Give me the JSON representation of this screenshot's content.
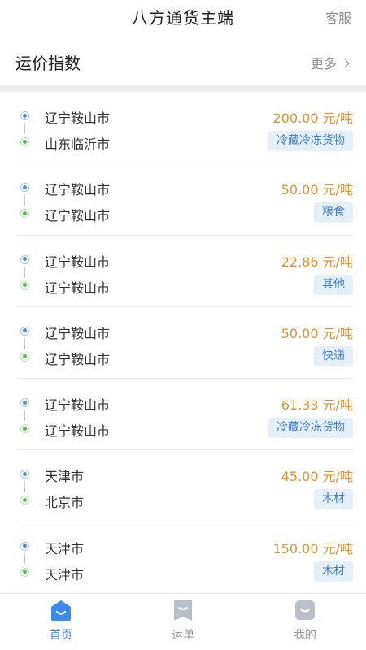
{
  "header": {
    "title": "八方通货主端",
    "service_label": "客服"
  },
  "section": {
    "title": "运价指数",
    "more_label": "更多"
  },
  "routes": [
    {
      "from": "辽宁鞍山市",
      "to": "山东临沂市",
      "price": "200.00 元/吨",
      "cargo": "冷藏冷冻货物"
    },
    {
      "from": "辽宁鞍山市",
      "to": "辽宁鞍山市",
      "price": "50.00 元/吨",
      "cargo": "粮食"
    },
    {
      "from": "辽宁鞍山市",
      "to": "辽宁鞍山市",
      "price": "22.86 元/吨",
      "cargo": "其他"
    },
    {
      "from": "辽宁鞍山市",
      "to": "辽宁鞍山市",
      "price": "50.00 元/吨",
      "cargo": "快递"
    },
    {
      "from": "辽宁鞍山市",
      "to": "辽宁鞍山市",
      "price": "61.33 元/吨",
      "cargo": "冷藏冷冻货物"
    },
    {
      "from": "天津市",
      "to": "北京市",
      "price": "45.00 元/吨",
      "cargo": "木材"
    },
    {
      "from": "天津市",
      "to": "天津市",
      "price": "150.00 元/吨",
      "cargo": "木材"
    }
  ],
  "tabs": [
    {
      "label": "首页",
      "icon": "home-icon",
      "active": true
    },
    {
      "label": "运单",
      "icon": "waybill-icon",
      "active": false
    },
    {
      "label": "我的",
      "icon": "profile-icon",
      "active": false
    }
  ],
  "colors": {
    "accent": "#3d8be8",
    "price": "#e8902a",
    "tag_bg": "#e6f0fb",
    "tag_text": "#3d7fd8",
    "origin_dot": "#4a8ee0",
    "dest_dot": "#4cc44a"
  }
}
